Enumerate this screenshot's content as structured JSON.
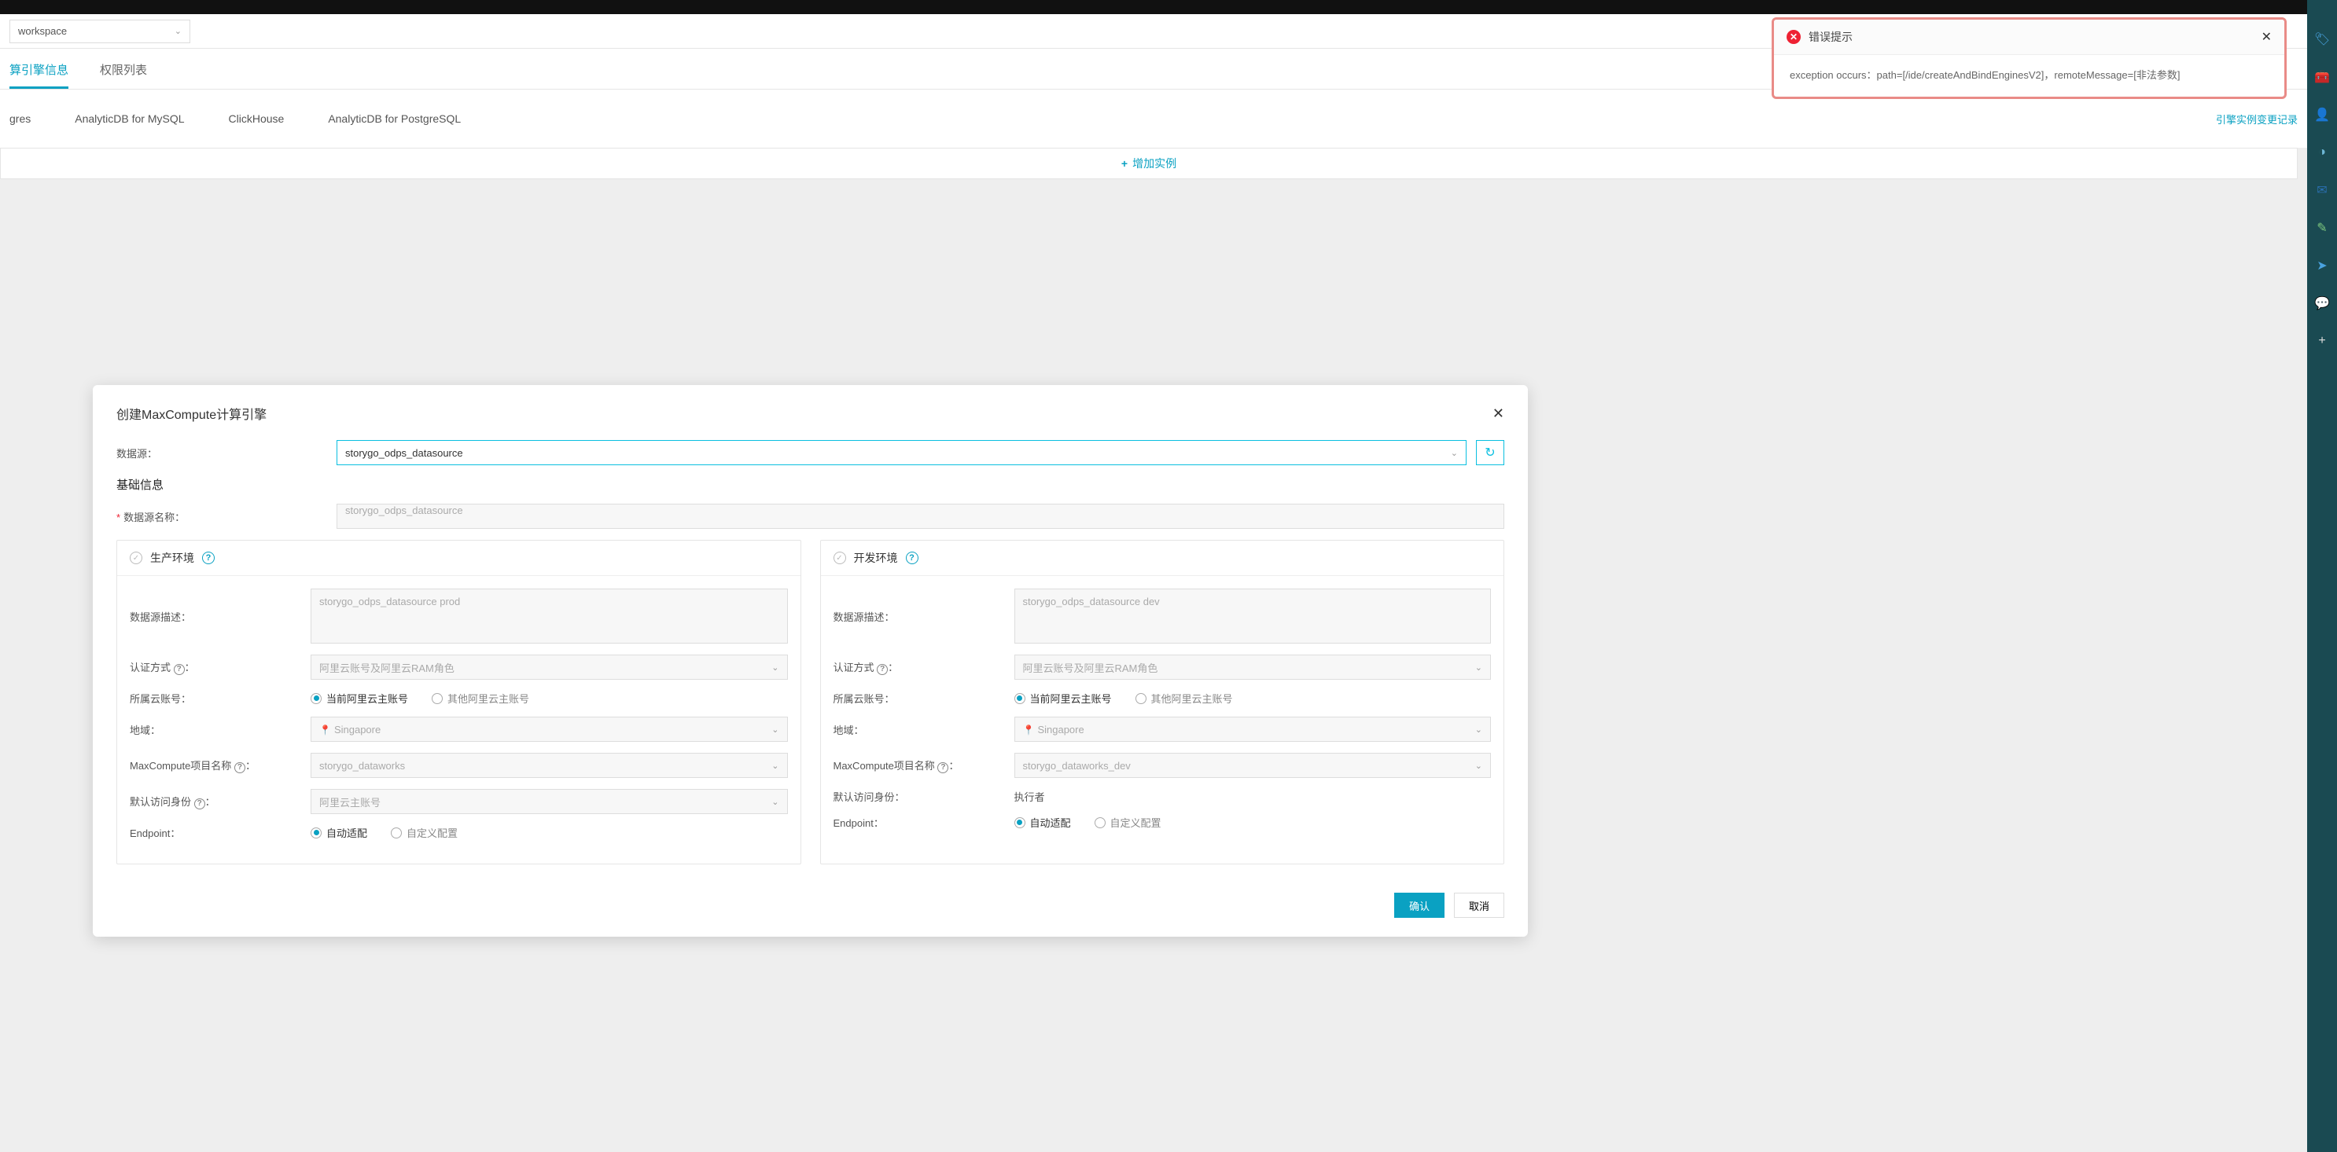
{
  "workspace": {
    "selected": "workspace"
  },
  "nav_tabs": {
    "engine_info": "算引擎信息",
    "permissions": "权限列表"
  },
  "engine_tabs": [
    "gres",
    "AnalyticDB for MySQL",
    "ClickHouse",
    "AnalyticDB for PostgreSQL"
  ],
  "change_log_link": "引擎实例变更记录",
  "add_instance": "增加实例",
  "modal": {
    "title": "创建MaxCompute计算引擎",
    "datasource_label": "数据源：",
    "datasource_value": "storygo_odps_datasource",
    "section_basic": "基础信息",
    "name_label": "数据源名称：",
    "name_value": "storygo_odps_datasource",
    "prod_panel": "生产环境",
    "dev_panel": "开发环境",
    "desc_label": "数据源描述：",
    "prod_desc": "storygo_odps_datasource prod",
    "dev_desc": "storygo_odps_datasource dev",
    "auth_label": "认证方式",
    "auth_value": "阿里云账号及阿里云RAM角色",
    "account_label": "所属云账号：",
    "account_current": "当前阿里云主账号",
    "account_other": "其他阿里云主账号",
    "region_label": "地域：",
    "region_value": "Singapore",
    "project_label": "MaxCompute项目名称",
    "prod_project": "storygo_dataworks",
    "dev_project": "storygo_dataworks_dev",
    "identity_label": "默认访问身份",
    "identity_value": "阿里云主账号",
    "dev_identity_value": "执行者",
    "endpoint_label": "Endpoint：",
    "endpoint_auto": "自动适配",
    "endpoint_custom": "自定义配置",
    "ok": "确认",
    "cancel": "取消"
  },
  "toast": {
    "title": "错误提示",
    "body": "exception occurs：path=[/ide/createAndBindEnginesV2]，remoteMessage=[非法参数]"
  },
  "rail_icons": [
    "tag",
    "toolbox",
    "user",
    "shape",
    "mail",
    "edit",
    "send",
    "chat",
    "plus"
  ],
  "colors": {
    "accent": "#0aa1c2",
    "error": "#e23",
    "rail": "#1a4a52"
  }
}
